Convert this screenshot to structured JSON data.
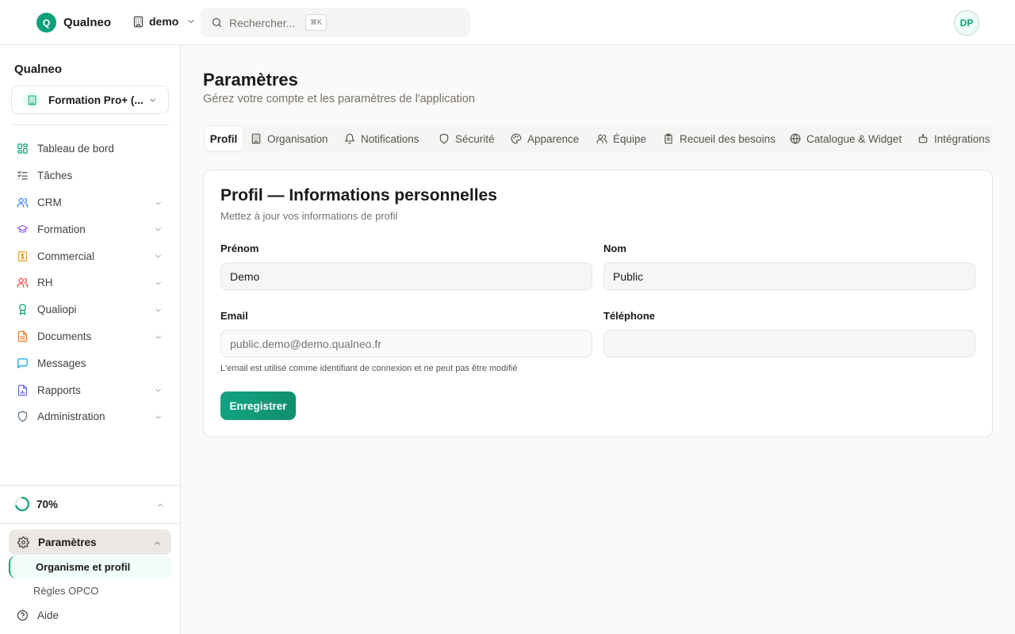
{
  "topbar": {
    "brand_letter": "Q",
    "brand_name": "Qualneo",
    "org_name": "demo",
    "search_placeholder": "Rechercher...",
    "search_shortcut": "⌘K",
    "avatar_initials": "DP"
  },
  "sidebar": {
    "title": "Qualneo",
    "org_select_label": "Formation Pro+ (...",
    "items": [
      {
        "label": "Tableau de bord",
        "icon": "dashboard-icon",
        "color": "#0f9f7a"
      },
      {
        "label": "Tâches",
        "icon": "tasks-icon",
        "color": "#57534e"
      },
      {
        "label": "CRM",
        "icon": "users-icon",
        "color": "#3b82f6"
      },
      {
        "label": "Formation",
        "icon": "graduation-cap-icon",
        "color": "#8b5cf6"
      },
      {
        "label": "Commercial",
        "icon": "dollar-icon",
        "color": "#f59e0b"
      },
      {
        "label": "RH",
        "icon": "users-icon",
        "color": "#ef4444"
      },
      {
        "label": "Qualiopi",
        "icon": "award-icon",
        "color": "#0f9f7a"
      },
      {
        "label": "Documents",
        "icon": "document-icon",
        "color": "#f97316"
      },
      {
        "label": "Messages",
        "icon": "message-icon",
        "color": "#0ea5e9"
      },
      {
        "label": "Rapports",
        "icon": "report-icon",
        "color": "#6366f1"
      },
      {
        "label": "Administration",
        "icon": "shield-icon",
        "color": "#64748b"
      }
    ],
    "progress": {
      "percent_label": "70%",
      "value": 0.7
    },
    "settings": {
      "label": "Paramètres",
      "sub_active": "Organisme et profil",
      "sub_other": "Règles OPCO"
    },
    "help_label": "Aide"
  },
  "main": {
    "title": "Paramètres",
    "subtitle": "Gérez votre compte et les paramètres de l'application",
    "tabs": [
      {
        "label": "Profil"
      },
      {
        "label": "Organisation"
      },
      {
        "label": "Notifications"
      },
      {
        "label": "Sécurité"
      },
      {
        "label": "Apparence"
      },
      {
        "label": "Équipe"
      },
      {
        "label": "Recueil des besoins"
      },
      {
        "label": "Catalogue & Widget"
      },
      {
        "label": "Intégrations"
      }
    ],
    "card": {
      "title": "Profil — Informations personnelles",
      "subtitle": "Mettez à jour vos informations de profil",
      "first_name_label": "Prénom",
      "first_name_value": "Demo",
      "last_name_label": "Nom",
      "last_name_value": "Public",
      "email_label": "Email",
      "email_placeholder": "public.demo@demo.qualneo.fr",
      "phone_label": "Téléphone",
      "phone_value": "",
      "email_hint": "L'email est utilisé comme identifiant de connexion et ne peut pas être modifié",
      "save_label": "Enregistrer"
    }
  },
  "colors": {
    "accent": "#0f9f7a",
    "active_bg": "#ebe8e3"
  }
}
